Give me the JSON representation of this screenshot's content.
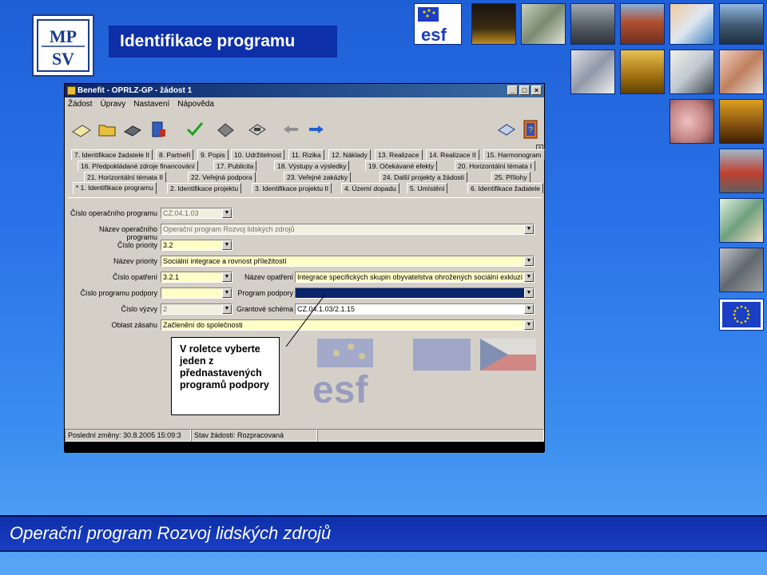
{
  "header": {
    "logo_text": "MPSV",
    "title": "Identifikace programu"
  },
  "window": {
    "title": "Benefit - OPRLZ-GP - žádost 1",
    "controls": [
      "_",
      "□",
      "×"
    ],
    "menu": [
      "Žádost",
      "Úpravy",
      "Nastavení",
      "Nápověda"
    ]
  },
  "toolbar_icons": [
    "new-document-icon",
    "open-folder-icon",
    "save-disk-icon",
    "print-icon",
    "check-icon",
    "stamp-icon",
    "printer-icon",
    "back-arrow-icon",
    "forward-arrow-icon",
    "mail-icon",
    "help-book-icon"
  ],
  "tabs": {
    "row1": [
      "7. Identifikace žadatele II",
      "8. Partneři",
      "9. Popis",
      "10. Udržitelnost",
      "11. Rizika",
      "12. Náklady",
      "13. Realizace",
      "14. Realizace II",
      "15. Harmonogram"
    ],
    "row2": [
      "16. Předpokládané zdroje financování",
      "17. Publicita",
      "18. Výstupy a výsledky",
      "19. Očekávané efekty",
      "20. Horizontální témata I"
    ],
    "row3": [
      "21. Horizontální témata II",
      "22. Veřejná podpora",
      "23. Veřejné zakázky",
      "24. Další projekty a žádosti",
      "25. Přílohy"
    ],
    "row4": [
      "* 1. Identifikace programu",
      "2. Identifikace projektu",
      "3. Identifikace projektu II",
      "4. Území dopadu",
      "5. Umístění",
      "6. Identifikace žadatele"
    ]
  },
  "form": {
    "cislo_op_label": "Číslo operačního programu",
    "cislo_op_value": "CZ.04.1.03",
    "nazev_op_label": "Název operačního programu",
    "nazev_op_value": "Operační program Rozvoj lidských zdrojů",
    "cislo_priority_label": "Číslo priority",
    "cislo_priority_value": "3.2",
    "nazev_priority_label": "Název priority",
    "nazev_priority_value": "Sociální integrace a rovnost příležitostí",
    "cislo_opatreni_label": "Číslo opatření",
    "cislo_opatreni_value": "3.2.1",
    "nazev_opatreni_label": "Název opatření",
    "nazev_opatreni_value": "Integrace specifických skupin obyvatelstva ohrožených sociální exkluzí",
    "cislo_pp_label": "Číslo programu podpory",
    "cislo_pp_value": "",
    "program_podpory_label": "Program podpory",
    "program_podpory_value": "",
    "cislo_vyzvy_label": "Číslo výzvy",
    "cislo_vyzvy_value": "2",
    "grantove_schema_label": "Grantové schéma",
    "grantove_schema_value": "CZ.04.1.03/2.1.15",
    "oblast_zasahu_label": "Oblast zásahu",
    "oblast_zasahu_value": "Začlenění do společnosti"
  },
  "status": {
    "last_change": "Poslední změny: 30.8.2005 15:09:3",
    "state": "Stav žádosti: Rozpracovaná"
  },
  "callout": {
    "text": "V roletce vyberte jeden z přednastavených programů podpory"
  },
  "footer": {
    "text": "Operační program Rozvoj lidských zdrojů"
  },
  "colors": {
    "background": "#2a73e8",
    "title_box": "#0d2fa8",
    "field_yellow": "#ffffc8",
    "selected_field": "#0a246a",
    "footer": "#0d2fa8"
  }
}
